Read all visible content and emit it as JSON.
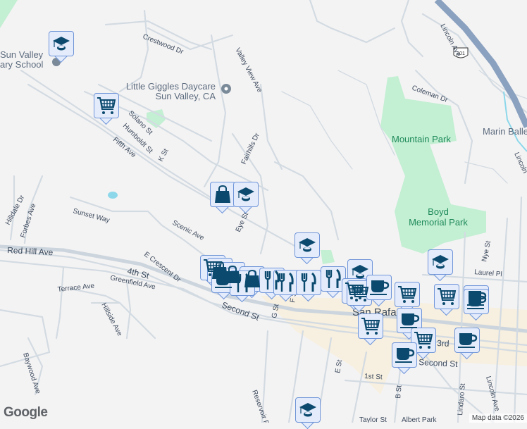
{
  "map": {
    "streets": {
      "crestwood": "Crestwood Dr",
      "valley_view": "Valley View Ave",
      "solano": "Solano St",
      "humboldt": "Humboldt St",
      "k_st": "K St",
      "fifth": "Fifth Ave",
      "fairhills": "Fairhills Dr",
      "eye": "Eye St",
      "hilldale": "Hilldale Dr",
      "forbes": "Forbes Ave",
      "sunset": "Sunset Way",
      "scenic": "Scenic Ave",
      "red_hill": "Red Hill Ave",
      "fourth": "4th St",
      "e_crescent": "E Crescent Dr",
      "terrace": "Terrace Ave",
      "greenfield": "Greenfield Ave",
      "hillside": "Hillside Ave",
      "baywood": "Baywood Ave",
      "second": "Second St",
      "second_east": "Second St",
      "reservoir": "Reservoir Rd",
      "g_st": "G St",
      "f_st": "F St",
      "e_st": "E St",
      "b_st": "B St",
      "first": "1st St",
      "third": "3rd",
      "lincoln": "Lincoln Ave",
      "lincoln2": "Lincoln Ave",
      "lincoln3": "Lincoln",
      "coleman": "Coleman Dr",
      "laurel": "Laurel Pl",
      "nye": "Nye St",
      "lindaro": "Lindaro St",
      "taylor": "Taylor St",
      "albert": "Albert Park",
      "hwy": "101"
    },
    "places": {
      "school": "Sun Valley\nElementary School",
      "school_line1": "Sun Valley",
      "school_line2": "ary School",
      "daycare_line1": "Little Giggles Daycare",
      "daycare_line2": "Sun Valley, CA",
      "mountain_park": "Mountain Park",
      "boyd_line1": "Boyd",
      "boyd_line2": "Memorial Park",
      "marin": "Marin Balle",
      "san_rafael": "San Rafael"
    },
    "markers": [
      "school",
      "cart",
      "bag",
      "school",
      "school",
      "cart",
      "bag",
      "bag",
      "cup",
      "bag",
      "fork",
      "fork",
      "fork",
      "fork",
      "fork",
      "school",
      "school",
      "cart",
      "cart",
      "cup",
      "cart",
      "cart",
      "cup",
      "cup",
      "cart",
      "cup",
      "cart",
      "cup",
      "cup",
      "school"
    ],
    "colors": {
      "marker_bg": "#e4ecfc",
      "marker_border": "#6f95d8",
      "icon": "#0b4a6e",
      "park": "#c3efd3",
      "highway": "#8aa1bf"
    },
    "attribution": "Map data ©2026",
    "logo": "Google"
  }
}
